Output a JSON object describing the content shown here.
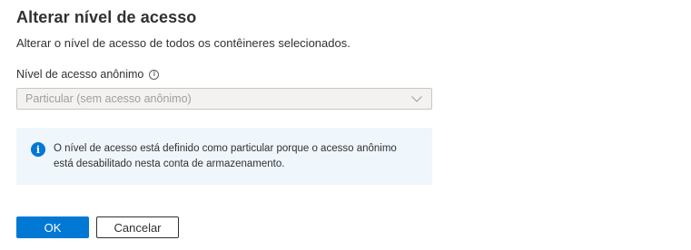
{
  "dialog": {
    "title": "Alterar nível de acesso",
    "subtitle": "Alterar o nível de acesso de todos os contêineres selecionados.",
    "field": {
      "label": "Nível de acesso anônimo",
      "info_icon": "info-icon",
      "selected_value": "Particular (sem acesso anônimo)",
      "disabled": true
    },
    "info_message": {
      "icon": "info-filled-icon",
      "line1": "O nível de acesso está definido como particular porque o acesso anônimo",
      "line2": "está desabilitado nesta conta de armazenamento."
    },
    "buttons": {
      "ok_label": "OK",
      "cancel_label": "Cancelar"
    }
  },
  "colors": {
    "accent": "#0078d4",
    "info_background": "#eff6fc",
    "disabled_text": "#a19f9d"
  }
}
